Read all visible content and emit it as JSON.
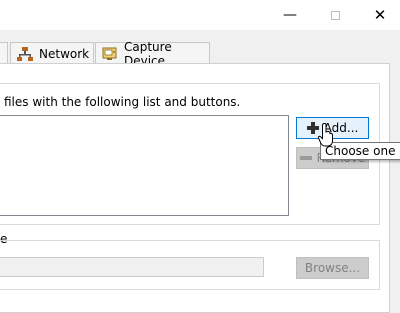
{
  "window": {
    "minimize_glyph": "—",
    "close_glyph": "✕"
  },
  "tabs": [
    {
      "label": "Network",
      "icon": "network-icon"
    },
    {
      "label": "Capture Device",
      "icon": "capture-device-icon"
    }
  ],
  "files_section": {
    "description": "files with the following list and buttons.",
    "add_label": "Add...",
    "remove_label": "Remove",
    "tooltip": "Choose one or more files"
  },
  "path_section": {
    "label_fragment": "e",
    "browse_label": "Browse...",
    "input_value": ""
  },
  "colors": {
    "add_border": "#0078d7",
    "add_bg": "#e5f1fb",
    "disabled_text": "#838383"
  }
}
